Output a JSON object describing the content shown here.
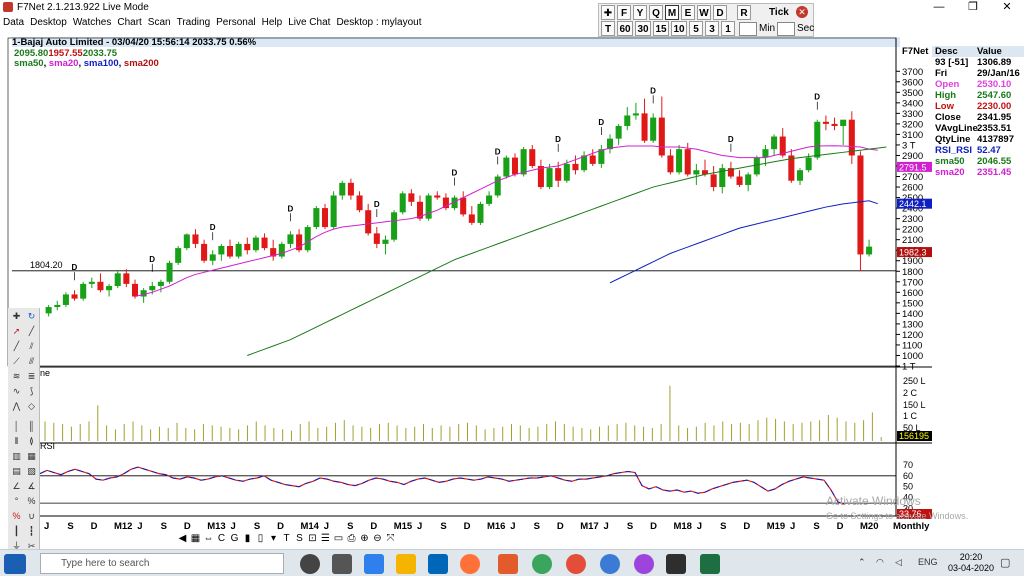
{
  "window": {
    "title": "F7Net 2.1.213.922 Live Mode",
    "controls": {
      "minimize": "—",
      "maximize": "❐",
      "close": "✕"
    }
  },
  "menu": [
    "Data",
    "Desktop",
    "Watches",
    "Chart",
    "Scan",
    "Trading",
    "Personal",
    "Help",
    "Live Chat",
    "Desktop : mylayout"
  ],
  "timeframe_toolbar": {
    "row1": [
      "✚",
      "F",
      "Y",
      "Q",
      "M",
      "E",
      "W",
      "D",
      "R"
    ],
    "tick_label": "Tick",
    "row2": [
      "T",
      "60",
      "30",
      "15",
      "10",
      "5",
      "3",
      "1"
    ],
    "min_label": "Min",
    "sec_label": "Sec",
    "active": "M"
  },
  "chart": {
    "header": "1-Bajaj Auto Limited - 03/04/20 15:56:14 2033.75 0.56%",
    "ohlc_line": [
      "2095.80",
      "1957.55",
      "2033.75"
    ],
    "sma_legend": [
      {
        "name": "sma50",
        "color": "#1a7a1a"
      },
      {
        "name": "sma20",
        "color": "#d020d0"
      },
      {
        "name": "sma100",
        "color": "#1020c0"
      },
      {
        "name": "sma200",
        "color": "#b01010"
      }
    ],
    "hline_label": "1804.20",
    "panel_top_label": "F7Net",
    "volume_label": "ne",
    "rsi_label": "RSI",
    "period": "Monthly",
    "dividend_marker": "D",
    "price_axis": [
      "3700",
      "3600",
      "3500",
      "3400",
      "3300",
      "3200",
      "3100",
      "3 T",
      "2900",
      "2800",
      "2700",
      "2600",
      "2500",
      "2400",
      "2300",
      "2200",
      "2100",
      "2000",
      "1900",
      "1800",
      "1700",
      "1600",
      "1500",
      "1400",
      "1300",
      "1200",
      "1100",
      "1000",
      "1 T"
    ],
    "price_tags": [
      {
        "value": "2791.5",
        "color": "#d020d0"
      },
      {
        "value": "2442.1",
        "color": "#1020c0"
      },
      {
        "value": "1982.3",
        "color": "#b01010"
      },
      {
        "value": "2033.75",
        "color": "#000000"
      }
    ],
    "volume_axis": [
      "250 L",
      "2 C",
      "150 L",
      "1 C",
      "50 L"
    ],
    "volume_tag": "156195",
    "rsi_axis": [
      "70",
      "60",
      "50",
      "40",
      "30"
    ],
    "rsi_tag": "33.76",
    "time_axis": [
      "J",
      "S",
      "D",
      "M12",
      "J",
      "S",
      "D",
      "M13",
      "J",
      "S",
      "D",
      "M14",
      "J",
      "S",
      "D",
      "M15",
      "J",
      "S",
      "D",
      "M16",
      "J",
      "S",
      "D",
      "M17",
      "J",
      "S",
      "D",
      "M18",
      "J",
      "S",
      "D",
      "M19",
      "J",
      "S",
      "D",
      "M20"
    ]
  },
  "chart_data": {
    "type": "candlestick",
    "title": "1-Bajaj Auto Limited - 03/04/20 15:56:14 2033.75 0.56%",
    "ylim": [
      900,
      3750
    ],
    "hline": 1804.2,
    "candles": [
      [
        1400,
        1480,
        1370,
        1460
      ],
      [
        1460,
        1520,
        1430,
        1480
      ],
      [
        1480,
        1600,
        1460,
        1580
      ],
      [
        1580,
        1620,
        1520,
        1540
      ],
      [
        1540,
        1700,
        1520,
        1680
      ],
      [
        1680,
        1740,
        1640,
        1700
      ],
      [
        1700,
        1780,
        1600,
        1620
      ],
      [
        1620,
        1680,
        1560,
        1660
      ],
      [
        1660,
        1800,
        1640,
        1780
      ],
      [
        1780,
        1820,
        1650,
        1680
      ],
      [
        1680,
        1720,
        1540,
        1560
      ],
      [
        1560,
        1640,
        1500,
        1620
      ],
      [
        1620,
        1700,
        1580,
        1660
      ],
      [
        1660,
        1720,
        1600,
        1700
      ],
      [
        1700,
        1900,
        1680,
        1880
      ],
      [
        1880,
        2040,
        1860,
        2020
      ],
      [
        2020,
        2160,
        2000,
        2150
      ],
      [
        2150,
        2200,
        2020,
        2060
      ],
      [
        2060,
        2100,
        1880,
        1900
      ],
      [
        1900,
        2000,
        1860,
        1960
      ],
      [
        1960,
        2060,
        1900,
        2040
      ],
      [
        2040,
        2100,
        1920,
        1940
      ],
      [
        1940,
        2080,
        1920,
        2060
      ],
      [
        2060,
        2120,
        1960,
        2000
      ],
      [
        2000,
        2140,
        1980,
        2120
      ],
      [
        2120,
        2160,
        2000,
        2020
      ],
      [
        2020,
        2100,
        1900,
        1940
      ],
      [
        1940,
        2080,
        1920,
        2060
      ],
      [
        2060,
        2180,
        2020,
        2150
      ],
      [
        2150,
        2200,
        1980,
        2000
      ],
      [
        2000,
        2240,
        1980,
        2220
      ],
      [
        2220,
        2420,
        2200,
        2400
      ],
      [
        2400,
        2440,
        2200,
        2220
      ],
      [
        2220,
        2560,
        2200,
        2520
      ],
      [
        2520,
        2660,
        2480,
        2640
      ],
      [
        2640,
        2680,
        2480,
        2520
      ],
      [
        2520,
        2560,
        2360,
        2380
      ],
      [
        2380,
        2440,
        2140,
        2160
      ],
      [
        2160,
        2220,
        2020,
        2060
      ],
      [
        2060,
        2140,
        1960,
        2100
      ],
      [
        2100,
        2380,
        2080,
        2360
      ],
      [
        2360,
        2560,
        2340,
        2540
      ],
      [
        2540,
        2580,
        2420,
        2460
      ],
      [
        2460,
        2520,
        2280,
        2300
      ],
      [
        2300,
        2540,
        2280,
        2520
      ],
      [
        2520,
        2560,
        2480,
        2500
      ],
      [
        2500,
        2540,
        2380,
        2400
      ],
      [
        2400,
        2520,
        2380,
        2500
      ],
      [
        2500,
        2560,
        2320,
        2340
      ],
      [
        2340,
        2420,
        2240,
        2260
      ],
      [
        2260,
        2460,
        2240,
        2440
      ],
      [
        2440,
        2560,
        2420,
        2520
      ],
      [
        2520,
        2720,
        2500,
        2700
      ],
      [
        2700,
        2900,
        2680,
        2880
      ],
      [
        2880,
        2920,
        2700,
        2720
      ],
      [
        2720,
        2980,
        2700,
        2960
      ],
      [
        2960,
        3000,
        2780,
        2800
      ],
      [
        2800,
        2860,
        2580,
        2600
      ],
      [
        2600,
        2820,
        2580,
        2780
      ],
      [
        2780,
        2840,
        2600,
        2660
      ],
      [
        2660,
        2860,
        2640,
        2820
      ],
      [
        2820,
        2900,
        2720,
        2760
      ],
      [
        2760,
        2940,
        2740,
        2900
      ],
      [
        2900,
        2960,
        2800,
        2820
      ],
      [
        2820,
        3000,
        2780,
        2960
      ],
      [
        2960,
        3100,
        2920,
        3060
      ],
      [
        3060,
        3200,
        3000,
        3180
      ],
      [
        3180,
        3360,
        3140,
        3280
      ],
      [
        3280,
        3400,
        3240,
        3300
      ],
      [
        3300,
        3440,
        3020,
        3040
      ],
      [
        3040,
        3300,
        3020,
        3260
      ],
      [
        3260,
        3460,
        2880,
        2900
      ],
      [
        2900,
        2960,
        2720,
        2740
      ],
      [
        2740,
        3000,
        2720,
        2960
      ],
      [
        2960,
        3020,
        2700,
        2720
      ],
      [
        2720,
        2820,
        2620,
        2760
      ],
      [
        2760,
        2860,
        2700,
        2720
      ],
      [
        2720,
        2800,
        2560,
        2600
      ],
      [
        2600,
        2820,
        2540,
        2780
      ],
      [
        2780,
        2840,
        2680,
        2700
      ],
      [
        2700,
        2760,
        2600,
        2620
      ],
      [
        2620,
        2740,
        2560,
        2720
      ],
      [
        2720,
        2900,
        2700,
        2880
      ],
      [
        2880,
        3000,
        2800,
        2960
      ],
      [
        2960,
        3100,
        2900,
        3080
      ],
      [
        3080,
        3160,
        2880,
        2900
      ],
      [
        2900,
        2960,
        2640,
        2660
      ],
      [
        2660,
        2780,
        2620,
        2760
      ],
      [
        2760,
        2920,
        2740,
        2880
      ],
      [
        2880,
        3240,
        2860,
        3220
      ],
      [
        3220,
        3280,
        3140,
        3200
      ],
      [
        3200,
        3260,
        3140,
        3180
      ],
      [
        3180,
        3220,
        3000,
        3240
      ],
      [
        3240,
        3320,
        2820,
        2900
      ],
      [
        2900,
        2940,
        1800,
        1960
      ],
      [
        1960,
        2100,
        1940,
        2034
      ]
    ],
    "sma_series": [
      {
        "name": "sma20",
        "color": "#d020d0",
        "start_index": 10,
        "values": [
          1560,
          1580,
          1600,
          1630,
          1660,
          1700,
          1740,
          1770,
          1790,
          1810,
          1830,
          1850,
          1870,
          1890,
          1910,
          1930,
          1950,
          1970,
          2000,
          2030,
          2080,
          2130,
          2170,
          2200,
          2220,
          2230,
          2240,
          2250,
          2260,
          2270,
          2280,
          2290,
          2300,
          2320,
          2350,
          2380,
          2420,
          2460,
          2500,
          2540,
          2580,
          2620,
          2660,
          2690,
          2720,
          2740,
          2760,
          2780,
          2790,
          2800,
          2830,
          2860,
          2890,
          2920,
          2950,
          2970,
          2980,
          2990,
          2990,
          2990,
          2990,
          2980,
          2980,
          2980,
          2970,
          2960,
          2940,
          2920,
          2900,
          2890,
          2880,
          2880,
          2880,
          2880,
          2900,
          2920,
          2940,
          2960,
          2980,
          2990,
          2991,
          2992,
          2990,
          2985,
          2980,
          2960,
          2950
        ]
      },
      {
        "name": "sma50",
        "color": "#1a7a1a",
        "start_index": 23,
        "values": [
          1000,
          1030,
          1060,
          1090,
          1120,
          1150,
          1190,
          1230,
          1270,
          1310,
          1350,
          1390,
          1430,
          1470,
          1510,
          1550,
          1590,
          1630,
          1670,
          1710,
          1750,
          1790,
          1830,
          1870,
          1910,
          1940,
          1970,
          2000,
          2030,
          2060,
          2090,
          2120,
          2150,
          2180,
          2210,
          2240,
          2270,
          2300,
          2330,
          2360,
          2390,
          2420,
          2450,
          2480,
          2510,
          2540,
          2570,
          2600,
          2620,
          2640,
          2660,
          2680,
          2700,
          2720,
          2735,
          2750,
          2765,
          2780,
          2795,
          2810,
          2825,
          2840,
          2855,
          2870,
          2880,
          2890,
          2900,
          2910,
          2920,
          2930,
          2940,
          2950,
          2960,
          2970,
          2980
        ]
      },
      {
        "name": "sma100",
        "color": "#1020c0",
        "start_index": 65,
        "values": [
          1690,
          1730,
          1770,
          1810,
          1850,
          1890,
          1930,
          1970,
          2000,
          2030,
          2060,
          2090,
          2120,
          2150,
          2180,
          2210,
          2230,
          2250,
          2270,
          2290,
          2310,
          2330,
          2350,
          2370,
          2390,
          2410,
          2425,
          2440,
          2450,
          2460,
          2470,
          2442
        ]
      }
    ],
    "dividend_indices": [
      1,
      13,
      25,
      37,
      49,
      61,
      73,
      85,
      97,
      109,
      121,
      133,
      145,
      151,
      157,
      163
    ],
    "volume": [
      30,
      28,
      26,
      22,
      26,
      30,
      55,
      24,
      18,
      26,
      30,
      24,
      18,
      22,
      20,
      28,
      20,
      18,
      26,
      24,
      22,
      20,
      18,
      24,
      30,
      24,
      20,
      18,
      16,
      26,
      30,
      20,
      22,
      28,
      32,
      24,
      22,
      20,
      26,
      28,
      24,
      20,
      22,
      26,
      20,
      24,
      22,
      26,
      28,
      24,
      18,
      20,
      22,
      26,
      24,
      20,
      22,
      26,
      30,
      26,
      22,
      20,
      18,
      22,
      24,
      26,
      28,
      24,
      22,
      20,
      26,
      85,
      24,
      20,
      22,
      28,
      24,
      30,
      26,
      28,
      26,
      32,
      36,
      34,
      30,
      26,
      28,
      30,
      32,
      40,
      36,
      30,
      28,
      32,
      44,
      6
    ],
    "rsi": [
      62,
      65,
      63,
      61,
      64,
      66,
      64,
      62,
      57,
      56,
      58,
      59,
      62,
      66,
      68,
      66,
      64,
      62,
      61,
      58,
      57,
      59,
      58,
      56,
      57,
      59,
      60,
      58,
      56,
      55,
      57,
      58,
      60,
      56,
      54,
      52,
      51,
      50,
      53,
      55,
      58,
      57,
      55,
      54,
      52,
      51,
      53,
      56,
      58,
      57,
      55,
      54,
      52,
      55,
      57,
      58,
      56,
      54,
      55,
      57,
      58,
      57,
      56,
      57,
      59,
      58,
      57,
      55,
      56,
      57,
      58,
      58,
      59,
      60,
      58,
      56,
      55,
      57,
      57,
      58,
      59,
      60,
      62,
      63,
      64,
      63,
      51,
      48,
      50,
      47,
      46,
      47,
      45,
      46,
      44,
      45,
      48,
      50,
      52,
      54,
      55,
      56,
      54,
      50,
      46,
      48,
      52,
      55,
      57,
      59,
      58,
      57,
      56,
      47,
      36,
      33.76
    ],
    "rsi_secondary_start": 70,
    "rsi_lines": [
      60,
      35
    ]
  },
  "info_panel": {
    "col_desc": "Desc",
    "col_value": "Value",
    "rows": [
      {
        "k": "93 [-51]",
        "v": "1306.89",
        "color": "#000"
      },
      {
        "k": "Fri",
        "v": "29/Jan/16",
        "color": "#000"
      },
      {
        "k": "Open",
        "v": "2530.10",
        "color": "#e040e0"
      },
      {
        "k": "High",
        "v": "2547.60",
        "color": "#1a7a1a"
      },
      {
        "k": "Low",
        "v": "2230.00",
        "color": "#c01010"
      },
      {
        "k": "Close",
        "v": "2341.95",
        "color": "#000"
      },
      {
        "k": "VAvgLine",
        "v": "2353.51",
        "color": "#000"
      },
      {
        "k": "QtyLine",
        "v": "4137897",
        "color": "#000"
      },
      {
        "k": "RSI_RSI",
        "v": "52.47",
        "color": "#1020c0"
      },
      {
        "k": "sma50",
        "v": "2046.55",
        "color": "#1a7a1a"
      },
      {
        "k": "sma20",
        "v": "2351.45",
        "color": "#d020d0"
      }
    ]
  },
  "taskbar": {
    "search_placeholder": "Type here to search",
    "tray_lang": "ENG",
    "clock_time": "20:20",
    "clock_date": "03-04-2020"
  },
  "watermark": {
    "line1": "Activate Windows",
    "line2": "Go to Settings to activate Windows."
  },
  "colors": {
    "bull": "#18a018",
    "bear": "#e01818",
    "rsi_primary": "#e01818",
    "rsi_secondary": "#1020c0",
    "volume": "#a0a030",
    "grid": "#000"
  }
}
